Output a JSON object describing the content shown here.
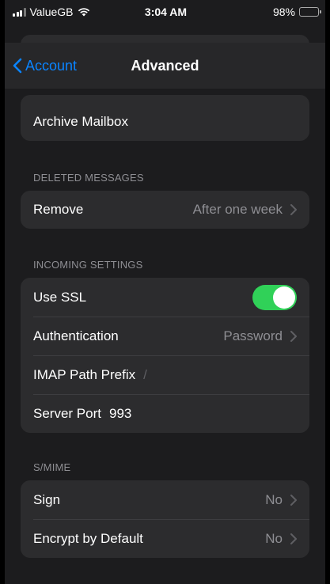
{
  "status": {
    "carrier": "ValueGB",
    "time": "3:04 AM",
    "battery": "98%",
    "battery_level": 0.98
  },
  "nav": {
    "back_label": "Account",
    "title": "Advanced"
  },
  "rows": {
    "archive_mailbox": "Archive Mailbox"
  },
  "deleted_messages": {
    "header": "DELETED MESSAGES",
    "remove_label": "Remove",
    "remove_value": "After one week"
  },
  "incoming": {
    "header": "INCOMING SETTINGS",
    "use_ssl_label": "Use SSL",
    "use_ssl_on": true,
    "auth_label": "Authentication",
    "auth_value": "Password",
    "imap_label": "IMAP Path Prefix",
    "imap_value": "/",
    "port_label": "Server Port",
    "port_value": "993"
  },
  "smime": {
    "header": "S/MIME",
    "sign_label": "Sign",
    "sign_value": "No",
    "encrypt_label": "Encrypt by Default",
    "encrypt_value": "No"
  },
  "colors": {
    "accent": "#0a84ff",
    "toggle_on": "#30d158",
    "background": "#1c1c1e",
    "card": "#2c2c2e"
  }
}
